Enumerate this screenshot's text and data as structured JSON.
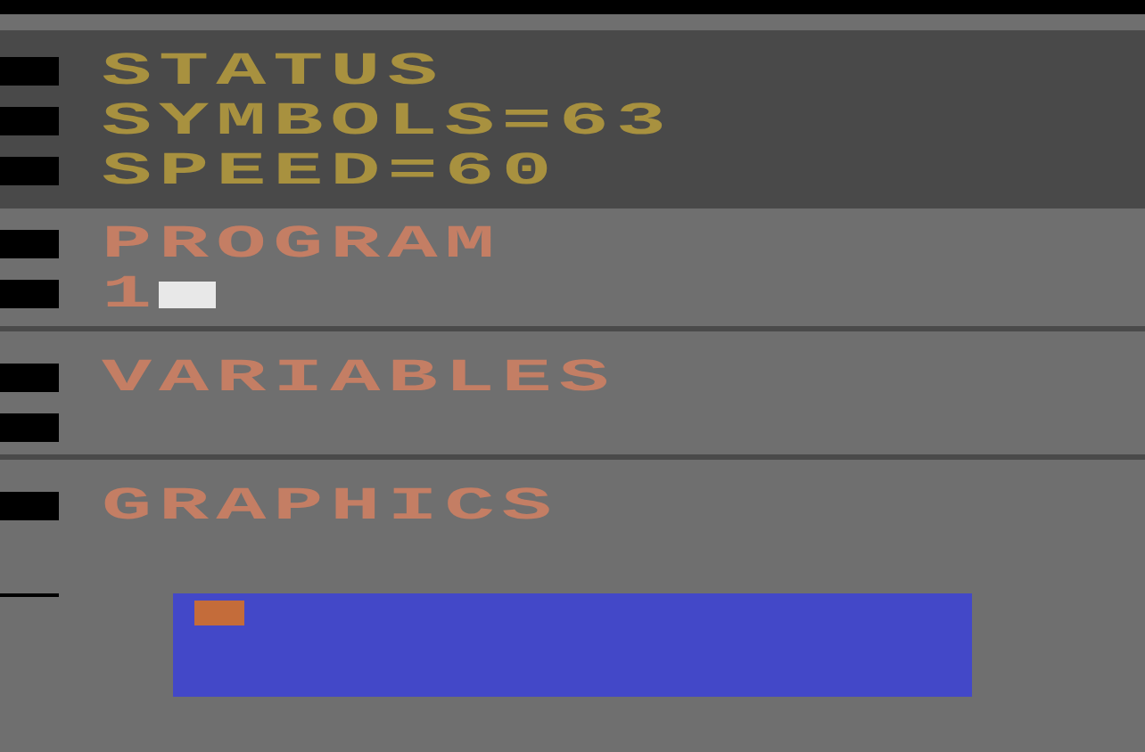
{
  "sections": [
    {
      "kind": "status",
      "lines": [
        {
          "kind": "text",
          "text": "STATUS"
        },
        {
          "kind": "text",
          "text": "SYMBOLS=63"
        },
        {
          "kind": "text",
          "text": "SPEED=60"
        }
      ]
    },
    {
      "kind": "program",
      "lines": [
        {
          "kind": "text",
          "text": "PROGRAM"
        },
        {
          "kind": "text",
          "text": "1",
          "cursor": true
        }
      ]
    },
    {
      "kind": "variables",
      "lines": [
        {
          "kind": "text",
          "text": "VARIABLES"
        },
        {
          "kind": "blank"
        }
      ]
    },
    {
      "kind": "graphics",
      "lines": [
        {
          "kind": "text",
          "text": "GRAPHICS"
        }
      ]
    }
  ]
}
